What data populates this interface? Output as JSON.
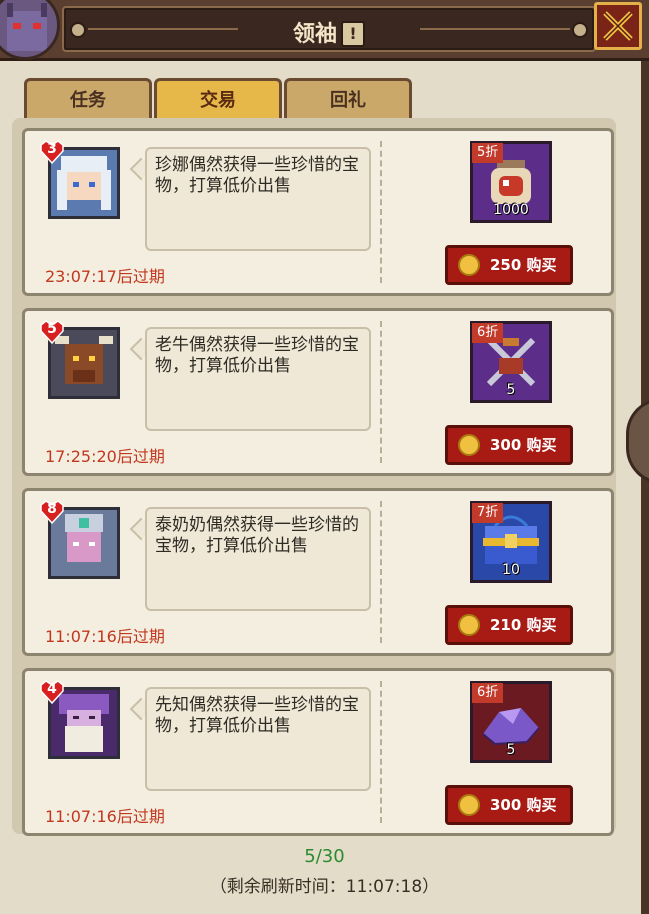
{
  "title": {
    "text": "领袖",
    "badge": "!"
  },
  "tabs": [
    {
      "label": "任务",
      "active": false
    },
    {
      "label": "交易",
      "active": true
    },
    {
      "label": "回礼",
      "active": false
    }
  ],
  "offers": [
    {
      "level": "3",
      "description": "珍娜偶然获得一些珍惜的宝物，打算低价出售",
      "expires": "23:07:17后过期",
      "discount": "5折",
      "quantity": "1000",
      "price": "250",
      "buy_label": "购买",
      "item_icon": "potion-jar-icon",
      "item_bg": "purple"
    },
    {
      "level": "5",
      "description": "老牛偶然获得一些珍惜的宝物，打算低价出售",
      "expires": "17:25:20后过期",
      "discount": "6折",
      "quantity": "5",
      "price": "300",
      "buy_label": "购买",
      "item_icon": "crossed-swords-icon",
      "item_bg": "purple"
    },
    {
      "level": "8",
      "description": "泰奶奶偶然获得一些珍惜的宝物，打算低价出售",
      "expires": "11:07:16后过期",
      "discount": "7折",
      "quantity": "10",
      "price": "210",
      "buy_label": "购买",
      "item_icon": "treasure-chest-icon",
      "item_bg": "blue"
    },
    {
      "level": "4",
      "description": "先知偶然获得一些珍惜的宝物，打算低价出售",
      "expires": "11:07:16后过期",
      "discount": "6折",
      "quantity": "5",
      "price": "300",
      "buy_label": "购买",
      "item_icon": "purple-crystal-icon",
      "item_bg": "red"
    }
  ],
  "footer": {
    "count": "5/30",
    "refresh": "（剩余刷新时间：11:07:18）"
  },
  "colors": {
    "accent_tab": "#e6b84a",
    "buy_button": "#a81a14",
    "expire_text": "#c2381e",
    "count_text": "#2e8a2e"
  }
}
